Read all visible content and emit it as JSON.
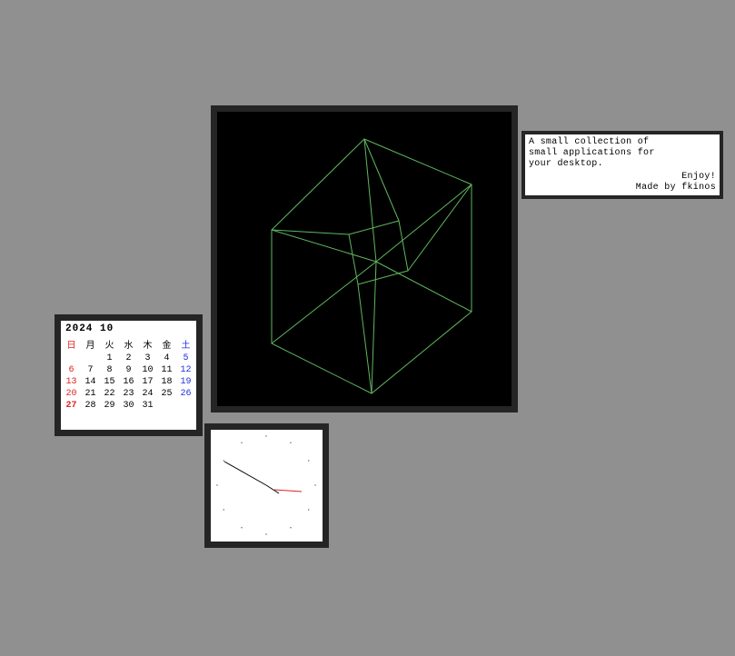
{
  "cube": {
    "stroke": "#5fb85f"
  },
  "info": {
    "line1": "A small collection of",
    "line2": "small applications for",
    "line3": "your desktop.",
    "sign1": "Enjoy!",
    "sign2": "Made by fkinos"
  },
  "calendar": {
    "year": "2024",
    "month": "10",
    "dow": [
      "日",
      "月",
      "火",
      "水",
      "木",
      "金",
      "土"
    ],
    "weeks": [
      [
        "",
        "",
        "1",
        "2",
        "3",
        "4",
        "5"
      ],
      [
        "6",
        "7",
        "8",
        "9",
        "10",
        "11",
        "12"
      ],
      [
        "13",
        "14",
        "15",
        "16",
        "17",
        "18",
        "19"
      ],
      [
        "20",
        "21",
        "22",
        "23",
        "24",
        "25",
        "26"
      ],
      [
        "27",
        "28",
        "29",
        "30",
        "31",
        "",
        ""
      ]
    ],
    "today": "27"
  },
  "clock": {
    "hour_hand_color": "#e02020",
    "min_hand_color": "#000",
    "sec_hand_color": "#000"
  }
}
